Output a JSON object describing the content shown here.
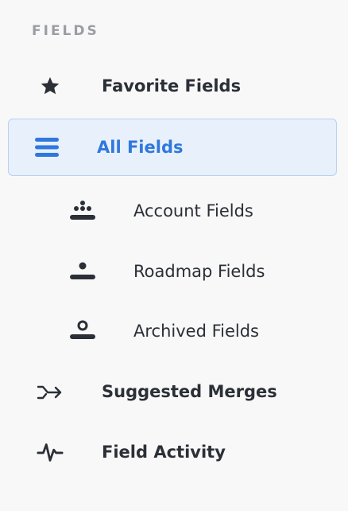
{
  "section": {
    "title": "FIELDS"
  },
  "nav": {
    "favorite": {
      "label": "Favorite Fields",
      "icon": "star-icon"
    },
    "all": {
      "label": "All Fields",
      "icon": "menu-lines-icon",
      "active": true
    },
    "account": {
      "label": "Account Fields",
      "icon": "account-people-icon"
    },
    "roadmap": {
      "label": "Roadmap Fields",
      "icon": "roadmap-user-icon"
    },
    "archived": {
      "label": "Archived Fields",
      "icon": "archived-user-icon"
    },
    "merges": {
      "label": "Suggested Merges",
      "icon": "merge-arrow-icon"
    },
    "activity": {
      "label": "Field Activity",
      "icon": "activity-pulse-icon"
    }
  },
  "colors": {
    "accent": "#2f78dc",
    "active_bg": "#e8f0fb",
    "active_border": "#b9d2f1",
    "text": "#2b2f36",
    "muted": "#9a9da3",
    "background": "#f8f8f9"
  }
}
